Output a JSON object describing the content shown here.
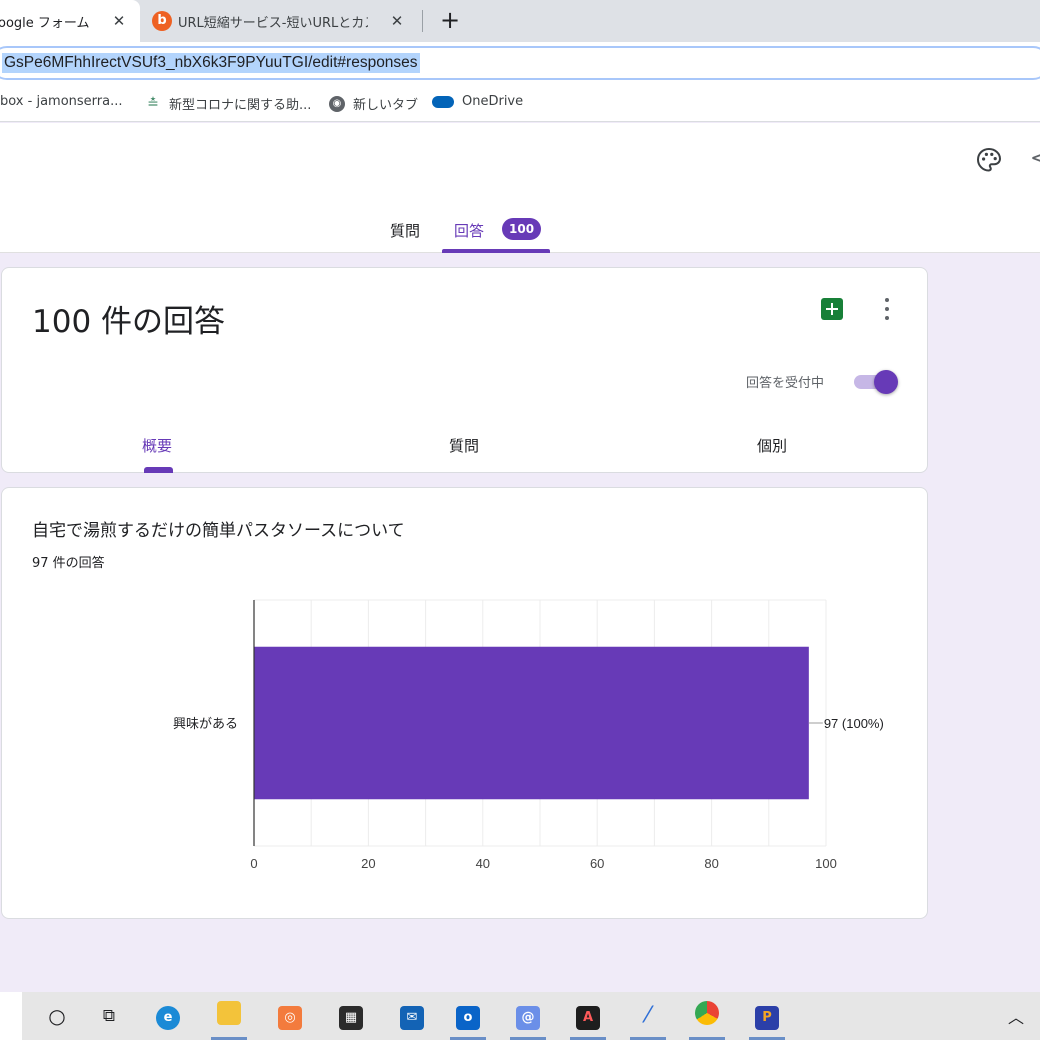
{
  "browser": {
    "active_tab_title": "oogle フォーム",
    "inactive_tab_title": "URL短縮サービス-短いURLとカスタム",
    "tab_close_glyph": "✕",
    "new_tab_glyph": "+",
    "url": "GsPe6MFhhIrectVSUf3_nbX6k3F9PYuuTGI/edit#responses",
    "bookmarks": [
      {
        "label": "box - jamonserra...",
        "icon": "none"
      },
      {
        "label": "新型コロナに関する助...",
        "icon": "news-icon"
      },
      {
        "label": "新しいタブ",
        "icon": "globe-icon"
      },
      {
        "label": "OneDrive",
        "icon": "cloud-icon"
      }
    ],
    "bitly_glyph": "b"
  },
  "form_header": {
    "tabs": {
      "questions": "質問",
      "responses": "回答"
    },
    "response_badge": "100",
    "share_glyph": "<"
  },
  "summary": {
    "title": "100 件の回答",
    "accepting_label": "回答を受付中",
    "accepting": true,
    "sub_tabs": {
      "summary": "概要",
      "questions": "質問",
      "individual": "個別"
    }
  },
  "question": {
    "title": "自宅で湯煎するだけの簡単パスタソースについて",
    "response_count": "97 件の回答"
  },
  "chart_data": {
    "type": "bar",
    "orientation": "horizontal",
    "categories": [
      "興味がある"
    ],
    "values": [
      97
    ],
    "data_labels": [
      "97 (100%)"
    ],
    "xlim": [
      0,
      100
    ],
    "xticks": [
      0,
      20,
      40,
      60,
      80,
      100
    ],
    "grid": true,
    "bar_color": "#673ab7"
  },
  "taskbar": {
    "items": [
      "cortana-icon",
      "task-view-icon",
      "edge-icon",
      "file-explorer-icon",
      "app-orange-icon",
      "store-icon",
      "mail-icon",
      "outlook-icon",
      "mail-app-icon",
      "acrobat-icon",
      "pen-icon",
      "chrome-icon",
      "powerpoint-icon"
    ],
    "tray_glyph": "︿"
  },
  "colors": {
    "accent": "#673ab7",
    "page_bg": "#f0ebf8",
    "sheets_green": "#188038"
  }
}
